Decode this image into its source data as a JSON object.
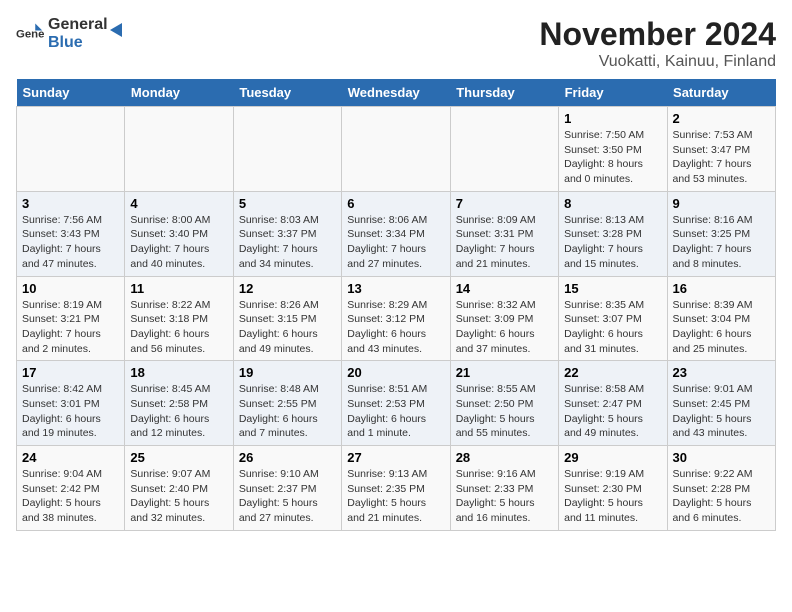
{
  "logo": {
    "general": "General",
    "blue": "Blue"
  },
  "title": "November 2024",
  "subtitle": "Vuokatti, Kainuu, Finland",
  "weekdays": [
    "Sunday",
    "Monday",
    "Tuesday",
    "Wednesday",
    "Thursday",
    "Friday",
    "Saturday"
  ],
  "weeks": [
    [
      {
        "day": "",
        "detail": ""
      },
      {
        "day": "",
        "detail": ""
      },
      {
        "day": "",
        "detail": ""
      },
      {
        "day": "",
        "detail": ""
      },
      {
        "day": "",
        "detail": ""
      },
      {
        "day": "1",
        "detail": "Sunrise: 7:50 AM\nSunset: 3:50 PM\nDaylight: 8 hours\nand 0 minutes."
      },
      {
        "day": "2",
        "detail": "Sunrise: 7:53 AM\nSunset: 3:47 PM\nDaylight: 7 hours\nand 53 minutes."
      }
    ],
    [
      {
        "day": "3",
        "detail": "Sunrise: 7:56 AM\nSunset: 3:43 PM\nDaylight: 7 hours\nand 47 minutes."
      },
      {
        "day": "4",
        "detail": "Sunrise: 8:00 AM\nSunset: 3:40 PM\nDaylight: 7 hours\nand 40 minutes."
      },
      {
        "day": "5",
        "detail": "Sunrise: 8:03 AM\nSunset: 3:37 PM\nDaylight: 7 hours\nand 34 minutes."
      },
      {
        "day": "6",
        "detail": "Sunrise: 8:06 AM\nSunset: 3:34 PM\nDaylight: 7 hours\nand 27 minutes."
      },
      {
        "day": "7",
        "detail": "Sunrise: 8:09 AM\nSunset: 3:31 PM\nDaylight: 7 hours\nand 21 minutes."
      },
      {
        "day": "8",
        "detail": "Sunrise: 8:13 AM\nSunset: 3:28 PM\nDaylight: 7 hours\nand 15 minutes."
      },
      {
        "day": "9",
        "detail": "Sunrise: 8:16 AM\nSunset: 3:25 PM\nDaylight: 7 hours\nand 8 minutes."
      }
    ],
    [
      {
        "day": "10",
        "detail": "Sunrise: 8:19 AM\nSunset: 3:21 PM\nDaylight: 7 hours\nand 2 minutes."
      },
      {
        "day": "11",
        "detail": "Sunrise: 8:22 AM\nSunset: 3:18 PM\nDaylight: 6 hours\nand 56 minutes."
      },
      {
        "day": "12",
        "detail": "Sunrise: 8:26 AM\nSunset: 3:15 PM\nDaylight: 6 hours\nand 49 minutes."
      },
      {
        "day": "13",
        "detail": "Sunrise: 8:29 AM\nSunset: 3:12 PM\nDaylight: 6 hours\nand 43 minutes."
      },
      {
        "day": "14",
        "detail": "Sunrise: 8:32 AM\nSunset: 3:09 PM\nDaylight: 6 hours\nand 37 minutes."
      },
      {
        "day": "15",
        "detail": "Sunrise: 8:35 AM\nSunset: 3:07 PM\nDaylight: 6 hours\nand 31 minutes."
      },
      {
        "day": "16",
        "detail": "Sunrise: 8:39 AM\nSunset: 3:04 PM\nDaylight: 6 hours\nand 25 minutes."
      }
    ],
    [
      {
        "day": "17",
        "detail": "Sunrise: 8:42 AM\nSunset: 3:01 PM\nDaylight: 6 hours\nand 19 minutes."
      },
      {
        "day": "18",
        "detail": "Sunrise: 8:45 AM\nSunset: 2:58 PM\nDaylight: 6 hours\nand 12 minutes."
      },
      {
        "day": "19",
        "detail": "Sunrise: 8:48 AM\nSunset: 2:55 PM\nDaylight: 6 hours\nand 7 minutes."
      },
      {
        "day": "20",
        "detail": "Sunrise: 8:51 AM\nSunset: 2:53 PM\nDaylight: 6 hours\nand 1 minute."
      },
      {
        "day": "21",
        "detail": "Sunrise: 8:55 AM\nSunset: 2:50 PM\nDaylight: 5 hours\nand 55 minutes."
      },
      {
        "day": "22",
        "detail": "Sunrise: 8:58 AM\nSunset: 2:47 PM\nDaylight: 5 hours\nand 49 minutes."
      },
      {
        "day": "23",
        "detail": "Sunrise: 9:01 AM\nSunset: 2:45 PM\nDaylight: 5 hours\nand 43 minutes."
      }
    ],
    [
      {
        "day": "24",
        "detail": "Sunrise: 9:04 AM\nSunset: 2:42 PM\nDaylight: 5 hours\nand 38 minutes."
      },
      {
        "day": "25",
        "detail": "Sunrise: 9:07 AM\nSunset: 2:40 PM\nDaylight: 5 hours\nand 32 minutes."
      },
      {
        "day": "26",
        "detail": "Sunrise: 9:10 AM\nSunset: 2:37 PM\nDaylight: 5 hours\nand 27 minutes."
      },
      {
        "day": "27",
        "detail": "Sunrise: 9:13 AM\nSunset: 2:35 PM\nDaylight: 5 hours\nand 21 minutes."
      },
      {
        "day": "28",
        "detail": "Sunrise: 9:16 AM\nSunset: 2:33 PM\nDaylight: 5 hours\nand 16 minutes."
      },
      {
        "day": "29",
        "detail": "Sunrise: 9:19 AM\nSunset: 2:30 PM\nDaylight: 5 hours\nand 11 minutes."
      },
      {
        "day": "30",
        "detail": "Sunrise: 9:22 AM\nSunset: 2:28 PM\nDaylight: 5 hours\nand 6 minutes."
      }
    ]
  ]
}
